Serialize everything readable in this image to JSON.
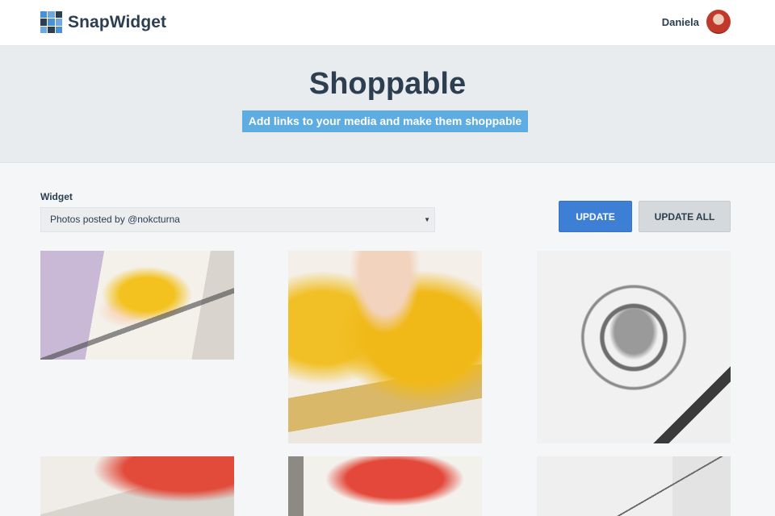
{
  "header": {
    "brand": "SnapWidget",
    "user_name": "Daniela",
    "logo_colors": [
      "#4a90d9",
      "#6fa8e0",
      "#2c3e50",
      "#2c3e50",
      "#4a90d9",
      "#6fa8e0",
      "#6fa8e0",
      "#2c3e50",
      "#4a90d9"
    ]
  },
  "hero": {
    "title": "Shoppable",
    "subtitle": "Add links to your media and make them shoppable"
  },
  "controls": {
    "widget_label": "Widget",
    "widget_selected": "Photos posted by @nokcturna",
    "update_label": "UPDATE",
    "update_all_label": "UPDATE ALL"
  },
  "colors": {
    "accent": "#3e7fd6",
    "subtitle_bg": "#5dade2",
    "text": "#2c3e50"
  }
}
